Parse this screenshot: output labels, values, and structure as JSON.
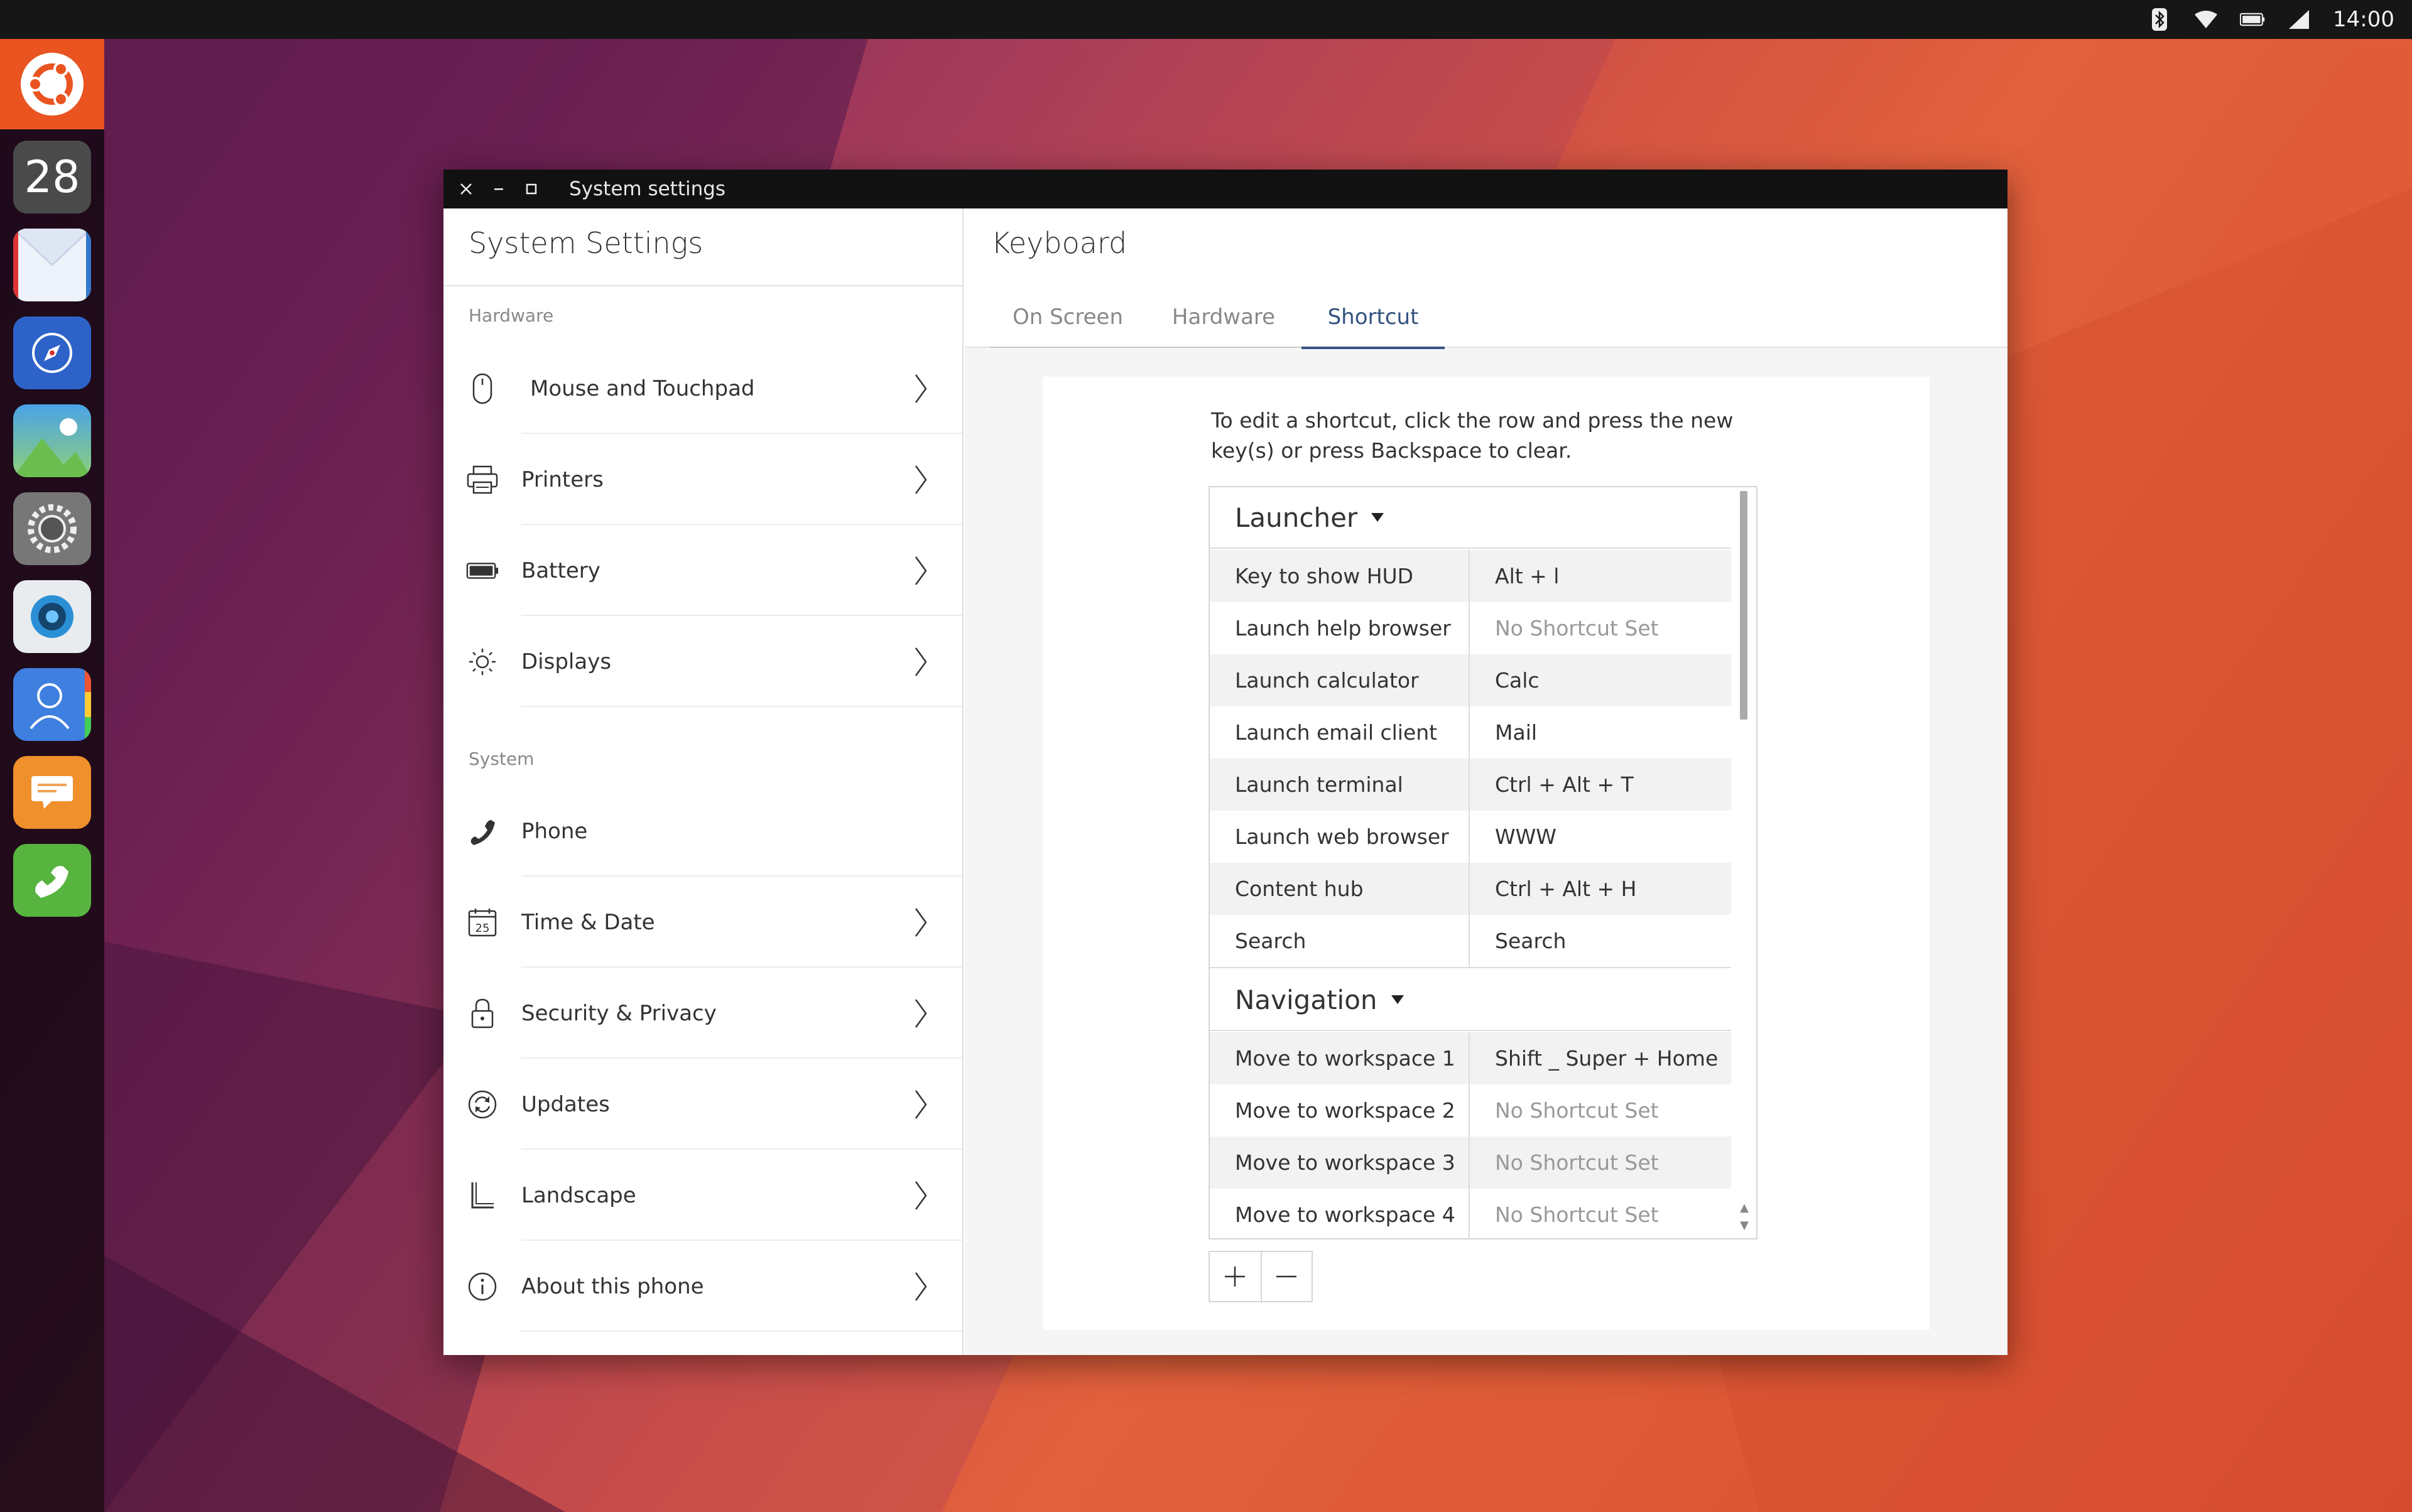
{
  "panel": {
    "clock": "14:00"
  },
  "launcher": {
    "calendar_day": "28"
  },
  "window": {
    "title": "System settings"
  },
  "left": {
    "title": "System Settings",
    "sections": [
      {
        "label": "Hardware",
        "items": [
          {
            "label": "Mouse and Touchpad",
            "icon": "mouse-icon"
          },
          {
            "label": "Printers",
            "icon": "printer-icon"
          },
          {
            "label": "Battery",
            "icon": "battery-icon"
          },
          {
            "label": "Displays",
            "icon": "brightness-icon"
          }
        ]
      },
      {
        "label": "System",
        "items": [
          {
            "label": "Phone",
            "icon": "phone-icon"
          },
          {
            "label": "Time & Date",
            "icon": "calendar-icon",
            "badge": "25"
          },
          {
            "label": "Security & Privacy",
            "icon": "lock-icon"
          },
          {
            "label": "Updates",
            "icon": "update-icon"
          },
          {
            "label": "Landscape",
            "icon": "landscape-icon"
          },
          {
            "label": "About this phone",
            "icon": "info-icon"
          }
        ]
      }
    ]
  },
  "right": {
    "title": "Keyboard",
    "tabs": [
      "On Screen",
      "Hardware",
      "Shortcut"
    ],
    "active_tab": "Shortcut",
    "hint": "To edit a shortcut, click the row and press the new key(s) or press Backspace to clear.",
    "groups": [
      {
        "name": "Launcher",
        "rows": [
          {
            "action": "Key to show HUD",
            "shortcut": "Alt + l"
          },
          {
            "action": "Launch help browser",
            "shortcut": "No Shortcut Set"
          },
          {
            "action": "Launch calculator",
            "shortcut": "Calc"
          },
          {
            "action": "Launch email client",
            "shortcut": "Mail"
          },
          {
            "action": "Launch terminal",
            "shortcut": "Ctrl + Alt + T"
          },
          {
            "action": "Launch web browser",
            "shortcut": "WWW"
          },
          {
            "action": "Content hub",
            "shortcut": "Ctrl + Alt + H"
          },
          {
            "action": "Search",
            "shortcut": "Search"
          }
        ]
      },
      {
        "name": "Navigation",
        "rows": [
          {
            "action": "Move to workspace 1",
            "shortcut": "Shift _ Super + Home"
          },
          {
            "action": "Move to workspace 2",
            "shortcut": "No Shortcut Set"
          },
          {
            "action": "Move to workspace 3",
            "shortcut": "No Shortcut Set"
          },
          {
            "action": "Move to workspace 4",
            "shortcut": "No Shortcut Set"
          }
        ]
      }
    ]
  },
  "colors": {
    "accent": "#335280",
    "ubuntu_orange": "#e95420"
  }
}
